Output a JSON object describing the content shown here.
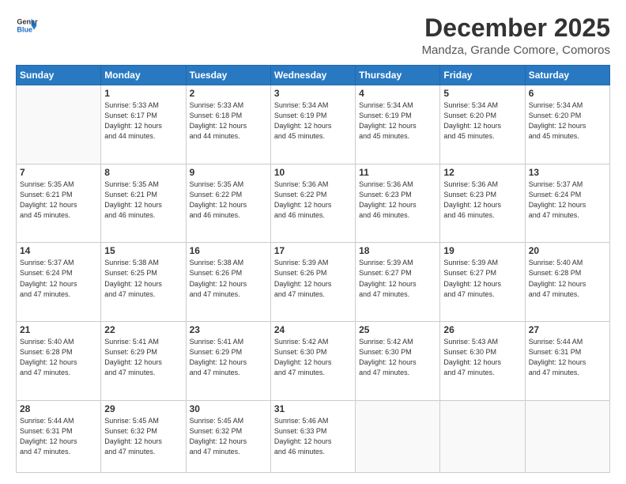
{
  "logo": {
    "line1": "General",
    "line2": "Blue"
  },
  "title": "December 2025",
  "subtitle": "Mandza, Grande Comore, Comoros",
  "headers": [
    "Sunday",
    "Monday",
    "Tuesday",
    "Wednesday",
    "Thursday",
    "Friday",
    "Saturday"
  ],
  "weeks": [
    [
      {
        "day": "",
        "info": ""
      },
      {
        "day": "1",
        "info": "Sunrise: 5:33 AM\nSunset: 6:17 PM\nDaylight: 12 hours\nand 44 minutes."
      },
      {
        "day": "2",
        "info": "Sunrise: 5:33 AM\nSunset: 6:18 PM\nDaylight: 12 hours\nand 44 minutes."
      },
      {
        "day": "3",
        "info": "Sunrise: 5:34 AM\nSunset: 6:19 PM\nDaylight: 12 hours\nand 45 minutes."
      },
      {
        "day": "4",
        "info": "Sunrise: 5:34 AM\nSunset: 6:19 PM\nDaylight: 12 hours\nand 45 minutes."
      },
      {
        "day": "5",
        "info": "Sunrise: 5:34 AM\nSunset: 6:20 PM\nDaylight: 12 hours\nand 45 minutes."
      },
      {
        "day": "6",
        "info": "Sunrise: 5:34 AM\nSunset: 6:20 PM\nDaylight: 12 hours\nand 45 minutes."
      }
    ],
    [
      {
        "day": "7",
        "info": "Sunrise: 5:35 AM\nSunset: 6:21 PM\nDaylight: 12 hours\nand 45 minutes."
      },
      {
        "day": "8",
        "info": "Sunrise: 5:35 AM\nSunset: 6:21 PM\nDaylight: 12 hours\nand 46 minutes."
      },
      {
        "day": "9",
        "info": "Sunrise: 5:35 AM\nSunset: 6:22 PM\nDaylight: 12 hours\nand 46 minutes."
      },
      {
        "day": "10",
        "info": "Sunrise: 5:36 AM\nSunset: 6:22 PM\nDaylight: 12 hours\nand 46 minutes."
      },
      {
        "day": "11",
        "info": "Sunrise: 5:36 AM\nSunset: 6:23 PM\nDaylight: 12 hours\nand 46 minutes."
      },
      {
        "day": "12",
        "info": "Sunrise: 5:36 AM\nSunset: 6:23 PM\nDaylight: 12 hours\nand 46 minutes."
      },
      {
        "day": "13",
        "info": "Sunrise: 5:37 AM\nSunset: 6:24 PM\nDaylight: 12 hours\nand 47 minutes."
      }
    ],
    [
      {
        "day": "14",
        "info": "Sunrise: 5:37 AM\nSunset: 6:24 PM\nDaylight: 12 hours\nand 47 minutes."
      },
      {
        "day": "15",
        "info": "Sunrise: 5:38 AM\nSunset: 6:25 PM\nDaylight: 12 hours\nand 47 minutes."
      },
      {
        "day": "16",
        "info": "Sunrise: 5:38 AM\nSunset: 6:26 PM\nDaylight: 12 hours\nand 47 minutes."
      },
      {
        "day": "17",
        "info": "Sunrise: 5:39 AM\nSunset: 6:26 PM\nDaylight: 12 hours\nand 47 minutes."
      },
      {
        "day": "18",
        "info": "Sunrise: 5:39 AM\nSunset: 6:27 PM\nDaylight: 12 hours\nand 47 minutes."
      },
      {
        "day": "19",
        "info": "Sunrise: 5:39 AM\nSunset: 6:27 PM\nDaylight: 12 hours\nand 47 minutes."
      },
      {
        "day": "20",
        "info": "Sunrise: 5:40 AM\nSunset: 6:28 PM\nDaylight: 12 hours\nand 47 minutes."
      }
    ],
    [
      {
        "day": "21",
        "info": "Sunrise: 5:40 AM\nSunset: 6:28 PM\nDaylight: 12 hours\nand 47 minutes."
      },
      {
        "day": "22",
        "info": "Sunrise: 5:41 AM\nSunset: 6:29 PM\nDaylight: 12 hours\nand 47 minutes."
      },
      {
        "day": "23",
        "info": "Sunrise: 5:41 AM\nSunset: 6:29 PM\nDaylight: 12 hours\nand 47 minutes."
      },
      {
        "day": "24",
        "info": "Sunrise: 5:42 AM\nSunset: 6:30 PM\nDaylight: 12 hours\nand 47 minutes."
      },
      {
        "day": "25",
        "info": "Sunrise: 5:42 AM\nSunset: 6:30 PM\nDaylight: 12 hours\nand 47 minutes."
      },
      {
        "day": "26",
        "info": "Sunrise: 5:43 AM\nSunset: 6:30 PM\nDaylight: 12 hours\nand 47 minutes."
      },
      {
        "day": "27",
        "info": "Sunrise: 5:44 AM\nSunset: 6:31 PM\nDaylight: 12 hours\nand 47 minutes."
      }
    ],
    [
      {
        "day": "28",
        "info": "Sunrise: 5:44 AM\nSunset: 6:31 PM\nDaylight: 12 hours\nand 47 minutes."
      },
      {
        "day": "29",
        "info": "Sunrise: 5:45 AM\nSunset: 6:32 PM\nDaylight: 12 hours\nand 47 minutes."
      },
      {
        "day": "30",
        "info": "Sunrise: 5:45 AM\nSunset: 6:32 PM\nDaylight: 12 hours\nand 47 minutes."
      },
      {
        "day": "31",
        "info": "Sunrise: 5:46 AM\nSunset: 6:33 PM\nDaylight: 12 hours\nand 46 minutes."
      },
      {
        "day": "",
        "info": ""
      },
      {
        "day": "",
        "info": ""
      },
      {
        "day": "",
        "info": ""
      }
    ]
  ]
}
